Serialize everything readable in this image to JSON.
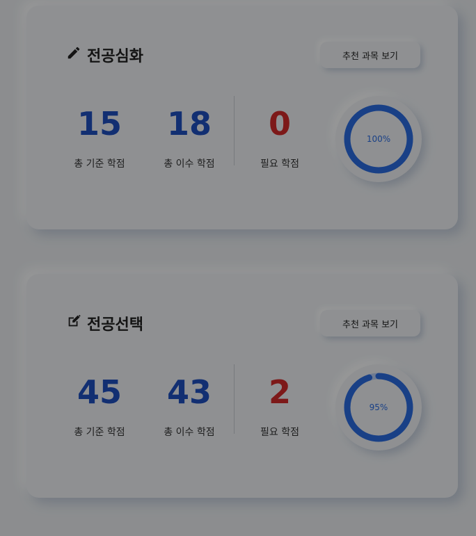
{
  "cards": [
    {
      "title": "전공심화",
      "icon": "pencil-icon",
      "button_label": "추천 과목 보기",
      "stats": [
        {
          "value": "15",
          "label": "총 기준 학점"
        },
        {
          "value": "18",
          "label": "총 이수 학점"
        },
        {
          "value": "0",
          "label": "필요 학점"
        }
      ],
      "progress_text": "100%",
      "progress_value": 1.0
    },
    {
      "title": "전공선택",
      "icon": "edit-square-icon",
      "button_label": "추천 과목 보기",
      "stats": [
        {
          "value": "45",
          "label": "총 기준 학점"
        },
        {
          "value": "43",
          "label": "총 이수 학점"
        },
        {
          "value": "2",
          "label": "필요 학점"
        }
      ],
      "progress_text": "95%",
      "progress_value": 0.95
    }
  ],
  "colors": {
    "blue": "#1f4fbf",
    "red": "#d12a2a",
    "gauge_fill": "#2b6be0",
    "gauge_track": "#b7cdf3"
  }
}
